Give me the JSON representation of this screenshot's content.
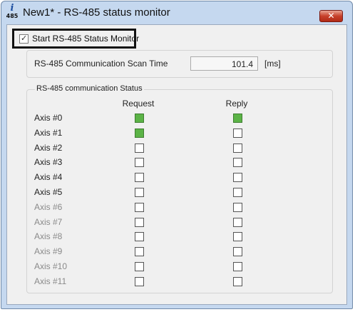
{
  "window": {
    "title": "New1* - RS-485 status monitor",
    "icon": {
      "name": "rs485-app-icon",
      "glyph": "i",
      "caption": "485"
    },
    "close_glyph": "✕"
  },
  "monitor_toggle": {
    "label": "Start RS-485 Status Monitor",
    "checked": true,
    "check_glyph": "✓"
  },
  "scan": {
    "label": "RS-485 Communication Scan Time",
    "value": "101.4",
    "unit": "[ms]"
  },
  "status": {
    "group_label": "RS-485 communication Status",
    "request_header": "Request",
    "reply_header": "Reply",
    "indicator_on_color": "#5bb346",
    "axes": [
      {
        "label": "Axis #0",
        "enabled": true,
        "request": true,
        "reply": true
      },
      {
        "label": "Axis #1",
        "enabled": true,
        "request": true,
        "reply": false
      },
      {
        "label": "Axis #2",
        "enabled": true,
        "request": false,
        "reply": false
      },
      {
        "label": "Axis #3",
        "enabled": true,
        "request": false,
        "reply": false
      },
      {
        "label": "Axis #4",
        "enabled": true,
        "request": false,
        "reply": false
      },
      {
        "label": "Axis #5",
        "enabled": true,
        "request": false,
        "reply": false
      },
      {
        "label": "Axis #6",
        "enabled": false,
        "request": false,
        "reply": false
      },
      {
        "label": "Axis #7",
        "enabled": false,
        "request": false,
        "reply": false
      },
      {
        "label": "Axis #8",
        "enabled": false,
        "request": false,
        "reply": false
      },
      {
        "label": "Axis #9",
        "enabled": false,
        "request": false,
        "reply": false
      },
      {
        "label": "Axis #10",
        "enabled": false,
        "request": false,
        "reply": false
      },
      {
        "label": "Axis #11",
        "enabled": false,
        "request": false,
        "reply": false
      }
    ]
  }
}
